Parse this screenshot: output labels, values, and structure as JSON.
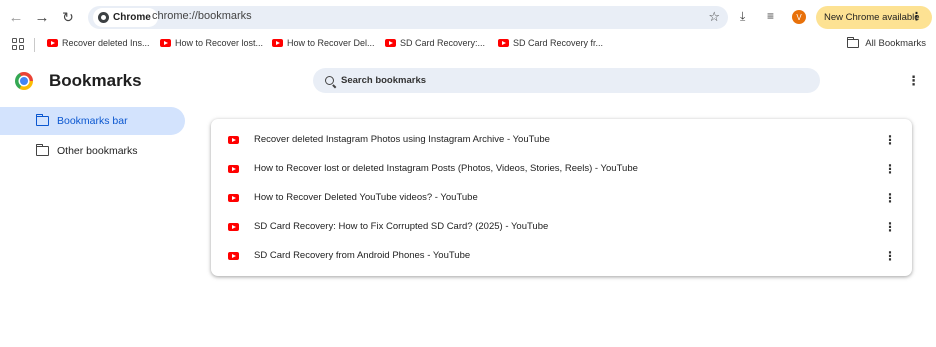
{
  "toolbar": {
    "back_icon": "arrow-left-icon",
    "forward_icon": "arrow-right-icon",
    "reload_icon": "reload-icon",
    "chip_label": "Chrome",
    "url": "chrome://bookmarks",
    "update_label": "New Chrome available",
    "avatar_letter": "V"
  },
  "bookmarks_bar": {
    "items": [
      {
        "label": "Recover deleted Ins..."
      },
      {
        "label": "How to Recover lost..."
      },
      {
        "label": "How to Recover Del..."
      },
      {
        "label": "SD Card Recovery:..."
      },
      {
        "label": "SD Card Recovery fr..."
      }
    ],
    "all_bookmarks_label": "All Bookmarks"
  },
  "page": {
    "title": "Bookmarks",
    "search_placeholder": "Search bookmarks"
  },
  "sidebar": {
    "items": [
      {
        "label": "Bookmarks bar",
        "active": true
      },
      {
        "label": "Other bookmarks",
        "active": false
      }
    ]
  },
  "list": {
    "rows": [
      {
        "title": "Recover deleted Instagram Photos using Instagram Archive - YouTube"
      },
      {
        "title": "How to Recover lost or deleted Instagram Posts (Photos, Videos, Stories, Reels) - YouTube"
      },
      {
        "title": "How to Recover Deleted YouTube videos? - YouTube"
      },
      {
        "title": "SD Card Recovery: How to Fix Corrupted SD Card? (2025) - YouTube"
      },
      {
        "title": "SD Card Recovery from Android Phones - YouTube"
      }
    ]
  },
  "colors": {
    "accent": "#0b57d0",
    "active_bg": "#d3e3fd",
    "update_pill": "#fde293",
    "youtube_red": "#ff0000"
  }
}
